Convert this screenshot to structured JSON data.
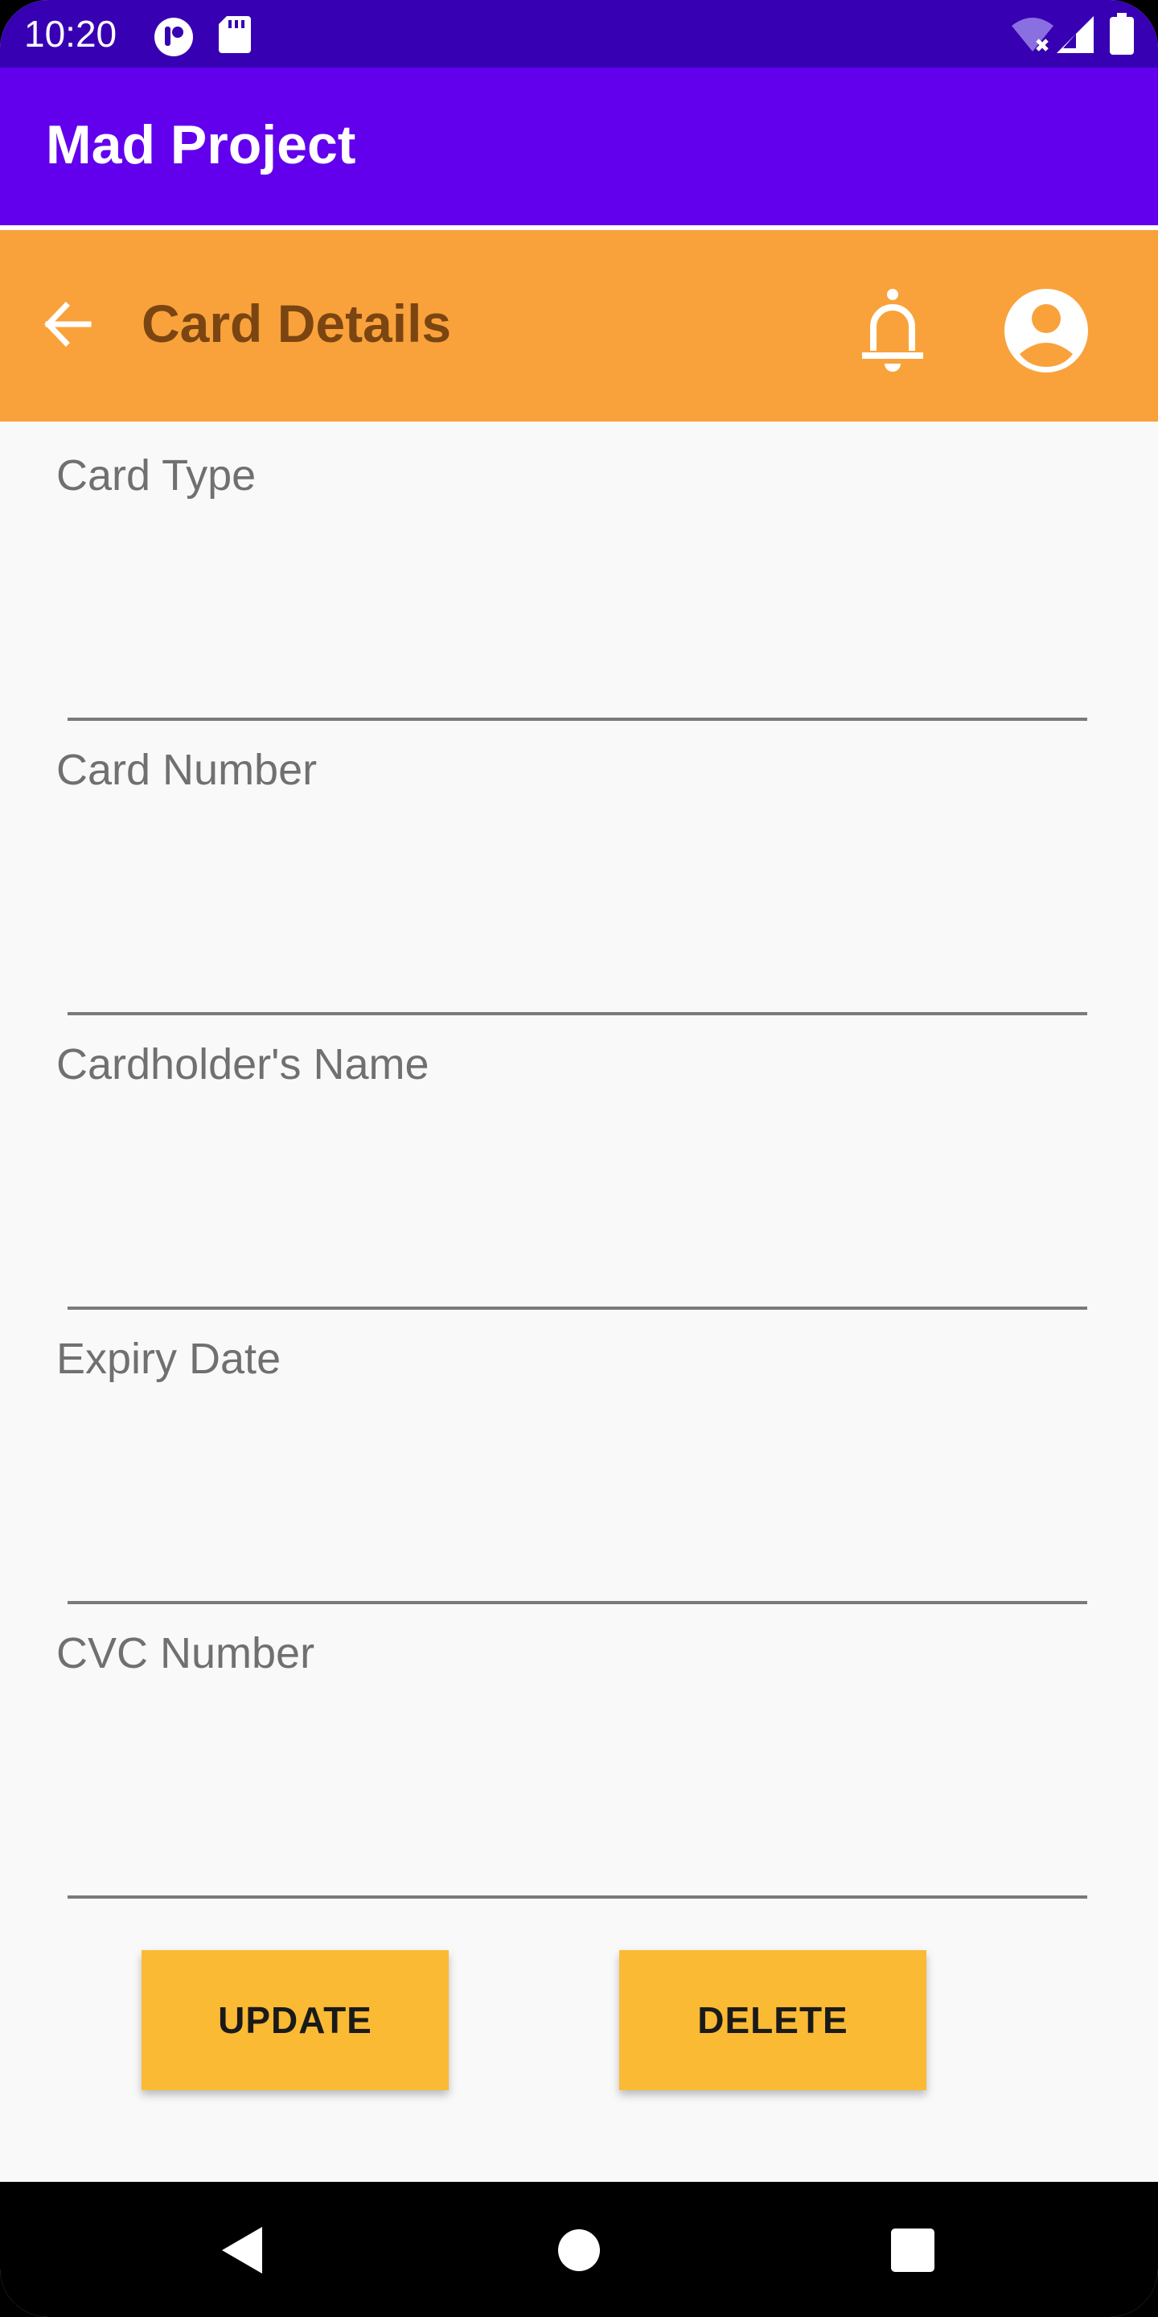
{
  "status_bar": {
    "time": "10:20",
    "icons": [
      "app-notification-icon",
      "sd-card-icon",
      "wifi-off-icon",
      "cell-signal-icon",
      "battery-icon"
    ],
    "color": "#3700B3"
  },
  "app_bar": {
    "title": "Mad Project",
    "color": "#6200EE"
  },
  "toolbar": {
    "title": "Card Details",
    "color": "#F9A23B",
    "back_icon": "arrow-left-icon",
    "bell_icon": "bell-icon",
    "profile_icon": "account-circle-icon"
  },
  "form": {
    "fields": [
      {
        "label": "Card Type",
        "value": ""
      },
      {
        "label": "Card Number",
        "value": ""
      },
      {
        "label": "Cardholder's Name",
        "value": ""
      },
      {
        "label": "Expiry Date",
        "value": ""
      },
      {
        "label": "CVC Number",
        "value": ""
      }
    ]
  },
  "actions": {
    "update_label": "UPDATE",
    "delete_label": "DELETE",
    "button_color": "#FBBA33"
  },
  "nav_bar": {
    "icons": [
      "back-triangle-icon",
      "home-circle-icon",
      "recents-square-icon"
    ]
  }
}
